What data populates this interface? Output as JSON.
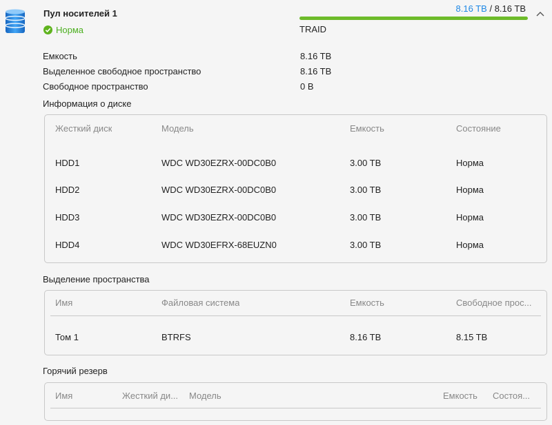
{
  "pool": {
    "title": "Пул носителей 1",
    "status": "Норма",
    "used": "8.16 TB",
    "separator": "/",
    "total": "8.16 TB",
    "usage_fraction": 1.0,
    "raid_type": "TRAID",
    "colors": {
      "accent": "#1e88e5",
      "ok": "#5fb31e",
      "bar": "#6dbb2a"
    }
  },
  "details": [
    {
      "label": "Емкость",
      "value": "8.16 TB"
    },
    {
      "label": "Выделенное свободное пространство",
      "value": "8.16 TB"
    },
    {
      "label": "Свободное пространство",
      "value": "0 B"
    }
  ],
  "disk_info": {
    "title": "Информация о диске",
    "headers": [
      "Жесткий диск",
      "Модель",
      "Емкость",
      "Состояние"
    ],
    "rows": [
      [
        "HDD1",
        "WDC WD30EZRX-00DC0B0",
        "3.00 TB",
        "Норма"
      ],
      [
        "HDD2",
        "WDC WD30EZRX-00DC0B0",
        "3.00 TB",
        "Норма"
      ],
      [
        "HDD3",
        "WDC WD30EZRX-00DC0B0",
        "3.00 TB",
        "Норма"
      ],
      [
        "HDD4",
        "WDC WD30EFRX-68EUZN0",
        "3.00 TB",
        "Норма"
      ]
    ]
  },
  "allocation": {
    "title": "Выделение пространства",
    "headers": [
      "Имя",
      "Файловая система",
      "Емкость",
      "Свободное прос..."
    ],
    "rows": [
      [
        "Том 1",
        "BTRFS",
        "8.16 TB",
        "8.15 TB"
      ]
    ]
  },
  "hot_spare": {
    "title": "Горячий резерв",
    "headers": [
      "Имя",
      "Жесткий ди...",
      "Модель",
      "Емкость",
      "Состоя..."
    ]
  },
  "icons": {
    "pool": "database-stack-icon",
    "status": "check-circle-icon",
    "collapse": "chevron-up-icon"
  }
}
